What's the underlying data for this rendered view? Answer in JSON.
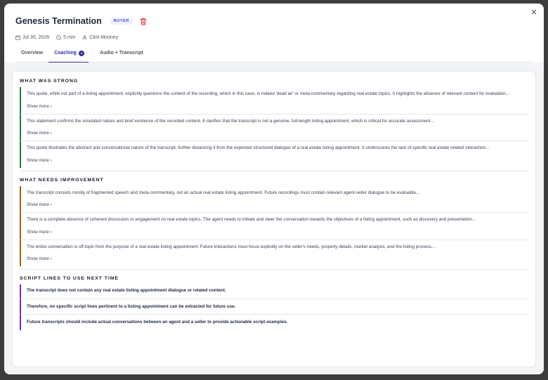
{
  "modal": {
    "close_label": "✕"
  },
  "header": {
    "title": "Genesis Termination",
    "badge": "BUYER",
    "date": "Jul 30, 2026",
    "duration": "5 min",
    "agent": "Clint Mooney"
  },
  "tabs": [
    {
      "label": "Overview"
    },
    {
      "label": "Coaching",
      "indicator": "●"
    },
    {
      "label": "Audio + Transcript"
    }
  ],
  "sections": {
    "strong": {
      "title": "WHAT WAS STRONG",
      "items": [
        {
          "text": "This quote, while not part of a listing appointment, explicitly questions the content of the recording, which in this case, is indeed 'dead air' or meta-commentary regarding real estate topics. It highlights the absence of relevant content for evaluation...",
          "more": "Show more ›"
        },
        {
          "text": "This statement confirms the simulated nature and brief existence of the recorded content. It clarifies that the transcript is not a genuine, full-length listing appointment, which is critical for accurate assessment...",
          "more": "Show more ›"
        },
        {
          "text": "This quote illustrates the abstract and conversational nature of the transcript, further distancing it from the expected structured dialogue of a real estate listing appointment. It underscores the lack of specific real estate related interaction...",
          "more": "Show more ›"
        }
      ]
    },
    "improve": {
      "title": "WHAT NEEDS IMPROVEMENT",
      "items": [
        {
          "text": "The transcript consists mostly of fragmented speech and meta-commentary, not an actual real estate listing appointment. Future recordings must contain relevant agent-seller dialogue to be evaluable...",
          "more": "Show more ›"
        },
        {
          "text": "There is a complete absence of coherent discussion or engagement on real estate topics. The agent needs to initiate and steer the conversation towards the objectives of a listing appointment, such as discovery and presentation...",
          "more": "Show more ›"
        },
        {
          "text": "The entire conversation is off-topic from the purpose of a real estate listing appointment. Future interactions must focus explicitly on the seller's needs, property details, market analysis, and the listing process...",
          "more": "Show more ›"
        }
      ]
    },
    "script": {
      "title": "SCRIPT LINES TO USE NEXT TIME",
      "items": [
        {
          "text": "The transcript does not contain any real estate listing appointment dialogue or related content."
        },
        {
          "text": "Therefore, no specific script lines pertinent to a listing appointment can be extracted for future use."
        },
        {
          "text": "Future transcripts should include actual conversations between an agent and a seller to provide actionable script examples."
        }
      ]
    }
  },
  "colors": {
    "strong_accent": "#15803d",
    "improve_accent": "#a16207",
    "script_accent": "#7e22ce",
    "tab_active": "#3730a3",
    "badge_text": "#4f46e5",
    "trash": "#dc2626"
  }
}
